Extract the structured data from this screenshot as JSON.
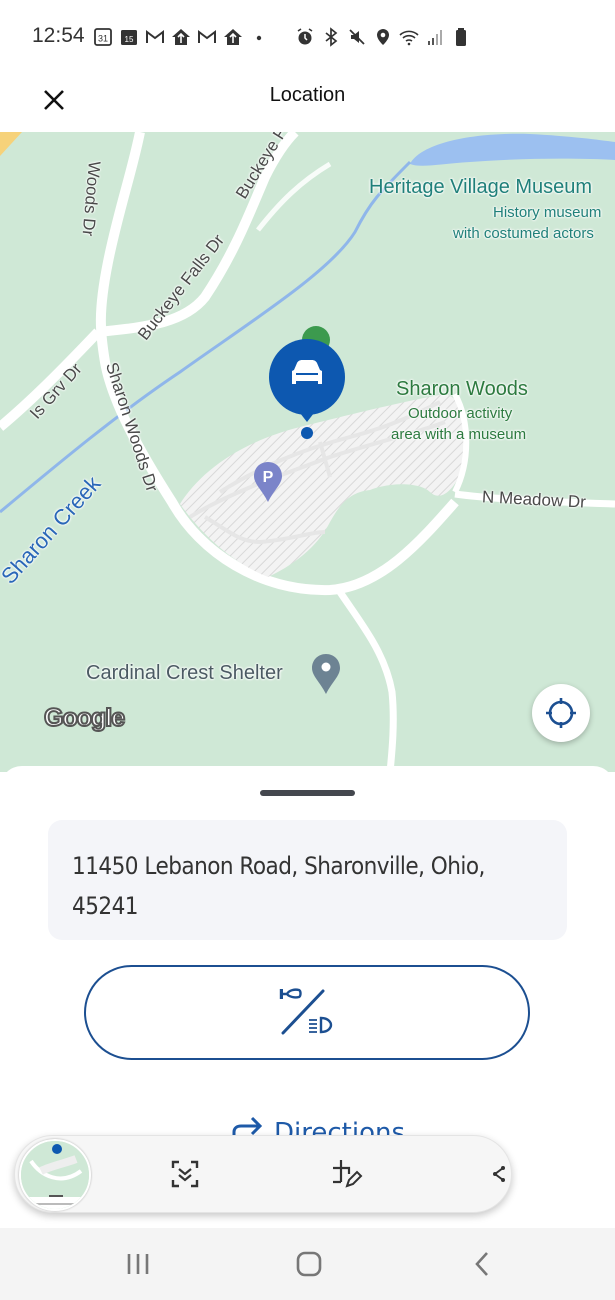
{
  "status_bar": {
    "time": "12:54",
    "left_icons": [
      "calendar-31-icon",
      "calendar-15-icon",
      "gmail-icon",
      "home-upload-icon",
      "gmail-icon",
      "home-upload-icon",
      "dot-icon"
    ],
    "right_icons": [
      "alarm-icon",
      "bluetooth-icon",
      "mute-icon",
      "location-icon",
      "wifi-icon",
      "signal-icon",
      "battery-icon"
    ],
    "calendar_day_a": "31",
    "calendar_day_b": "15"
  },
  "app_bar": {
    "title": "Location",
    "close_icon": "close-icon"
  },
  "map": {
    "labels": {
      "woods_dr_top": "Woods Dr",
      "buckeye_top": "Buckeye F",
      "buckeye_falls": "Buckeye Falls Dr",
      "buckeye_falls_2": "Buckeye Falls Dr",
      "is_grv": "Is Grv Dr",
      "sharon_woods_dr": "Sharon Woods Dr",
      "sharon_creek": "Sharon Creek",
      "n_meadow": "N Meadow Dr",
      "heritage_title": "Heritage Village Museum",
      "heritage_sub1": "History museum",
      "heritage_sub2": "with costumed actors",
      "sharon_woods_title": "Sharon Woods",
      "sharon_woods_sub1": "Outdoor activity",
      "sharon_woods_sub2": "area with a museum",
      "cardinal": "Cardinal Crest Shelter",
      "google": "Google",
      "parking": "P"
    },
    "colors": {
      "land": "#cfe8d6",
      "water": "#9cc0f0",
      "road": "#ffffff",
      "vehicle_pin": "#0d58b0",
      "parking_pin": "#7b84c9"
    },
    "locate_button_icon": "my-location-icon"
  },
  "sheet": {
    "address": "11450 Lebanon Road, Sharonville, Ohio, 45241",
    "horn_lights_icon": "horn-lights-icon",
    "directions_label": "Directions",
    "accent": "#1c4f91"
  },
  "screenshot_toolbar": {
    "thumbnail": "screenshot-thumbnail",
    "buttons": [
      "scroll-capture-icon",
      "edit-icon",
      "share-icon"
    ]
  },
  "nav_bar": {
    "buttons": [
      "recents-icon",
      "home-icon",
      "back-icon"
    ]
  }
}
